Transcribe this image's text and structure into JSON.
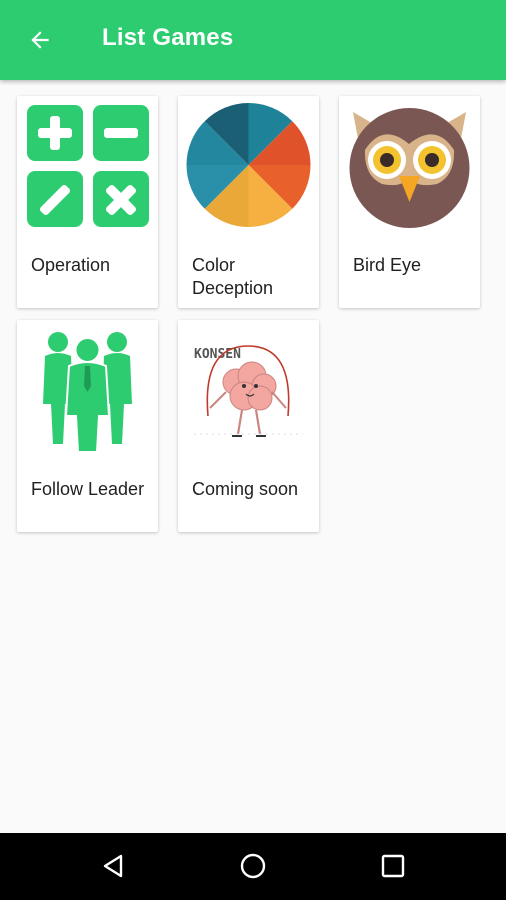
{
  "app_bar": {
    "title": "List Games",
    "back_icon": "arrow-left-icon",
    "color": "#2ecc71"
  },
  "games": [
    {
      "label": "Operation",
      "icon": "math-operations-icon"
    },
    {
      "label": "Color Deception",
      "icon": "color-wheel-icon"
    },
    {
      "label": "Bird Eye",
      "icon": "owl-icon"
    },
    {
      "label": "Follow Leader",
      "icon": "group-leader-icon"
    },
    {
      "label": "Coming soon",
      "icon": "brain-jump-rope-icon",
      "image_text": "KONSEN"
    }
  ],
  "nav_bar": {
    "back_icon": "triangle-back-icon",
    "home_icon": "circle-home-icon",
    "recents_icon": "square-recents-icon"
  }
}
